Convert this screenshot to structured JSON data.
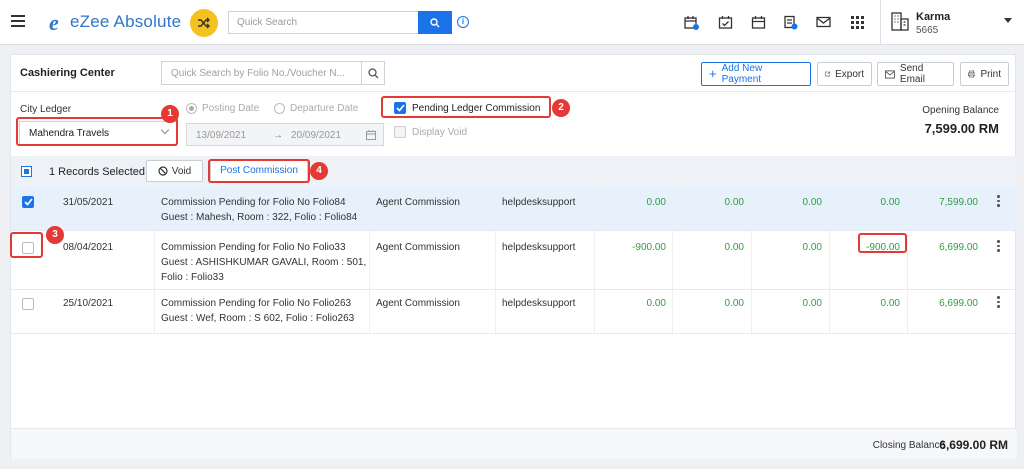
{
  "topbar": {
    "logo_text": "eZee Absolute",
    "search_placeholder": "Quick Search",
    "user": {
      "name": "Karma",
      "id": "5665"
    },
    "icons": [
      "calendar-plus-icon",
      "calendar-check-icon",
      "calendar-icon",
      "document-badge-icon",
      "mail-icon",
      "apps-grid-icon"
    ]
  },
  "header": {
    "title": "Cashiering Center",
    "folio_search_placeholder": "Quick Search by Folio No./Voucher N...",
    "actions": {
      "add_payment": "Add New Payment",
      "export": "Export",
      "send_email": "Send Email",
      "print": "Print"
    }
  },
  "filters": {
    "city_ledger_label": "City Ledger",
    "city_ledger_value": "Mahendra Travels",
    "posting_date_label": "Posting Date",
    "departure_date_label": "Departure Date",
    "date_from": "13/09/2021",
    "date_to": "20/09/2021",
    "pending_commission_label": "Pending Ledger Commission",
    "display_void_label": "Display Void",
    "opening_balance_label": "Opening Balance",
    "opening_balance_value": "7,599.00 RM"
  },
  "records_bar": {
    "selected_text": "1 Records Selected",
    "void_label": "Void",
    "post_commission_label": "Post Commission"
  },
  "rows": [
    {
      "date": "31/05/2021",
      "desc1": "Commission Pending for Folio No Folio84",
      "desc2": "Guest : Mahesh, Room : 322, Folio : Folio84",
      "desc3": "",
      "type": "Agent Commission",
      "user": "helpdesksupport",
      "c1": "0.00",
      "c2": "0.00",
      "c3": "0.00",
      "c4": "0.00",
      "balance": "7,599.00",
      "selected": true
    },
    {
      "date": "08/04/2021",
      "desc1": "Commission Pending for Folio No Folio33",
      "desc2": "Guest : ASHISHKUMAR GAVALI, Room : 501,",
      "desc3": "Folio : Folio33",
      "type": "Agent Commission",
      "user": "helpdesksupport",
      "c1": "-900.00",
      "c2": "0.00",
      "c3": "0.00",
      "c4": "-900.00",
      "balance": "6,699.00",
      "selected": false
    },
    {
      "date": "25/10/2021",
      "desc1": "Commission Pending for Folio No Folio263",
      "desc2": "Guest : Wef, Room : S 602, Folio : Folio263",
      "desc3": "",
      "type": "Agent Commission",
      "user": "helpdesksupport",
      "c1": "0.00",
      "c2": "0.00",
      "c3": "0.00",
      "c4": "0.00",
      "balance": "6,699.00",
      "selected": false
    }
  ],
  "closing": {
    "label": "Closing Balance",
    "value": "6,699.00 RM"
  },
  "annotations": [
    "1",
    "2",
    "3",
    "4"
  ],
  "colors": {
    "accent": "#1a73e8",
    "positive": "#2e9e3e",
    "annotation": "#e53935",
    "logo_badge": "#f4c21f"
  }
}
